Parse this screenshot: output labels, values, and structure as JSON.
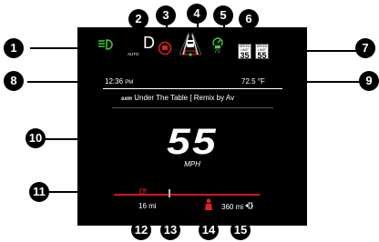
{
  "colors": {
    "screen_bg": "#000000",
    "headlight_green": "#3bd13b",
    "warning_red": "#e02020",
    "accent_red": "#d01818",
    "text": "#ffffff"
  },
  "status": {
    "headlight_sub": "AUTO",
    "gear": "D",
    "acc_set_speed": "70"
  },
  "speed_signs": [
    {
      "top": "SPEED",
      "middle": "LIMIT",
      "value": "35"
    },
    {
      "top": "SPEED",
      "middle": "LIMIT",
      "value": "55"
    }
  ],
  "info": {
    "time": "12:36",
    "time_suffix": "PM",
    "temperature": "72.5 °F"
  },
  "media": {
    "source": "sxm",
    "title": "Under The Table [ Remix by Av"
  },
  "speedometer": {
    "value": "55",
    "unit": "MPH"
  },
  "trip": {
    "trip_distance": "16 mi",
    "range": "360 mi"
  },
  "callouts": [
    "1",
    "2",
    "3",
    "4",
    "5",
    "6",
    "7",
    "8",
    "9",
    "10",
    "11",
    "12",
    "13",
    "14",
    "15"
  ],
  "icons": {
    "headlight": "auto-headlight-icon",
    "forward_collision": "forward-collision-warning-icon",
    "lane_sense": "lane-departure-icon",
    "adaptive_cruise": "adaptive-cruise-icon",
    "low_fuel": "low-fuel-icon",
    "fuel_pump": "fuel-pump-icon",
    "driver_warning": "driver-warning-icon"
  }
}
